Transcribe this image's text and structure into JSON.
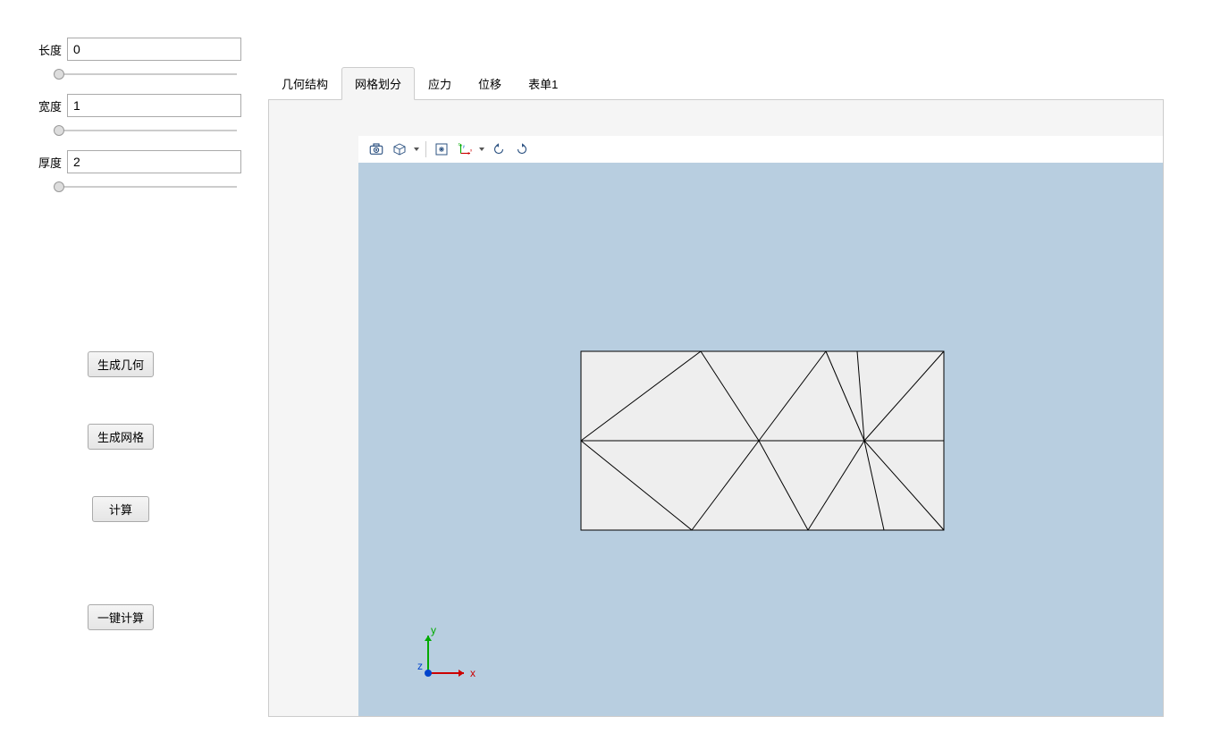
{
  "sidebar": {
    "params": [
      {
        "label": "长度",
        "value": "0"
      },
      {
        "label": "宽度",
        "value": "1"
      },
      {
        "label": "厚度",
        "value": "2"
      }
    ],
    "buttons": {
      "generate_geometry": "生成几何",
      "generate_mesh": "生成网格",
      "calculate": "计算",
      "one_click": "一键计算"
    }
  },
  "tabs": [
    {
      "label": "几何结构",
      "active": false
    },
    {
      "label": "网格划分",
      "active": true
    },
    {
      "label": "应力",
      "active": false
    },
    {
      "label": "位移",
      "active": false
    },
    {
      "label": "表单1",
      "active": false
    }
  ],
  "toolbar_icons": [
    "camera-icon",
    "cube-icon",
    "fit-icon",
    "axes-icon",
    "rotate-ccw-icon",
    "rotate-cw-icon"
  ],
  "axis_labels": {
    "x": "x",
    "y": "y",
    "z": "z"
  }
}
